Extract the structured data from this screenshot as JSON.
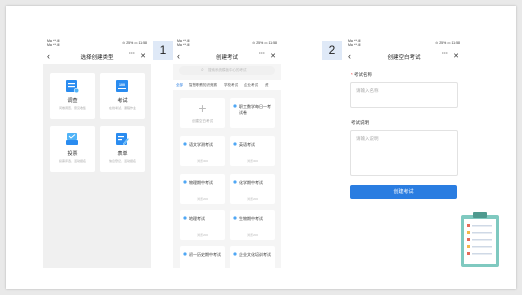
{
  "status": {
    "carrier": "Ma ⁴ᴳ.ill",
    "network": "Ma ⁴ᴳ.ill",
    "right": "⊙ 25% ▭ 11:58"
  },
  "screen1": {
    "title": "选择创建类型",
    "cards": [
      {
        "title": "调查",
        "sub": "问卷调查、意见收集"
      },
      {
        "title": "考试",
        "sub": "在线考试、课程作业"
      },
      {
        "title": "投票",
        "sub": "投票评选、活动报名"
      },
      {
        "title": "表单",
        "sub": "信息登记、活动报名"
      }
    ]
  },
  "screen2": {
    "badge": "1",
    "title": "创建考试",
    "search_placeholder": "搜索系统模板中心的考试",
    "tabs": [
      "全部",
      "智慧职教知识竞赛",
      "学校考试",
      "企业考试",
      "资"
    ],
    "add_label": "创建空白考试",
    "cards": [
      {
        "title": "职工数学每日一考试卷",
        "meta": ""
      },
      {
        "title": "语文学测考试",
        "meta": "浏览300"
      },
      {
        "title": "英语考试",
        "meta": "浏览300"
      },
      {
        "title": "物理期中考试",
        "meta": "浏览200"
      },
      {
        "title": "化学期中考试",
        "meta": "浏览200"
      },
      {
        "title": "地理考试",
        "meta": "浏览200"
      },
      {
        "title": "生物期中考试",
        "meta": "浏览200"
      },
      {
        "title": "初一历史期中考试",
        "meta": ""
      },
      {
        "title": "企业文化培训考试",
        "meta": ""
      }
    ]
  },
  "screen3": {
    "badge": "2",
    "title": "创建空白考试",
    "name_label": "考试名称",
    "name_placeholder": "请输入名称",
    "desc_label": "考试说明",
    "desc_placeholder": "请输入说明",
    "submit": "创建考试"
  }
}
